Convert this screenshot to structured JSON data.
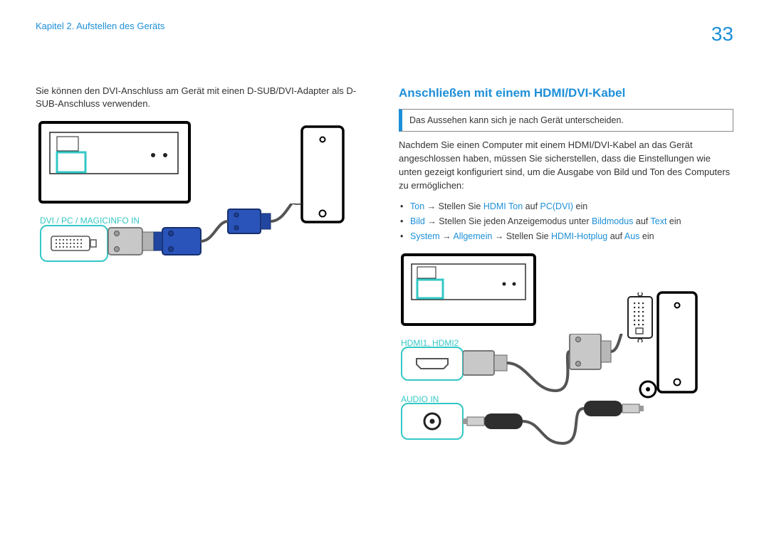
{
  "header": {
    "chapter": "Kapitel 2. Aufstellen des Geräts",
    "page_number": "33"
  },
  "left": {
    "intro": "Sie können den DVI-Anschluss am Gerät mit einen D-SUB/DVI-Adapter als D-SUB-Anschluss verwenden.",
    "port_label": "DVI / PC / MAGICINFO IN"
  },
  "right": {
    "title": "Anschließen mit einem HDMI/DVI-Kabel",
    "info_box": "Das Aussehen kann sich je nach Gerät unterscheiden.",
    "intro": "Nachdem Sie einen Computer mit einem HDMI/DVI-Kabel an das Gerät angeschlossen haben, müssen Sie sicherstellen, dass die Einstellungen wie unten gezeigt konfiguriert sind, um die Ausgabe von Bild und Ton des Computers zu ermöglichen:",
    "settings": [
      {
        "kw1": "Ton",
        "t1": " → Stellen Sie ",
        "kw2": "HDMI Ton",
        "t2": " auf ",
        "kw3": "PC(DVI)",
        "t3": " ein"
      },
      {
        "kw1": "Bild",
        "t1": " → Stellen Sie jeden Anzeigemodus unter ",
        "kw2": "Bildmodus",
        "t2": " auf ",
        "kw3": "Text",
        "t3": " ein"
      },
      {
        "kw1": "System",
        "t1": " → ",
        "kw2": "Allgemein",
        "t2": " → Stellen Sie ",
        "kw3": "HDMI-Hotplug",
        "t3": " auf ",
        "kw4": "Aus",
        "t4": " ein"
      }
    ],
    "port_label_hdmi": "HDMI1, HDMI2",
    "port_label_audio": "AUDIO IN"
  }
}
